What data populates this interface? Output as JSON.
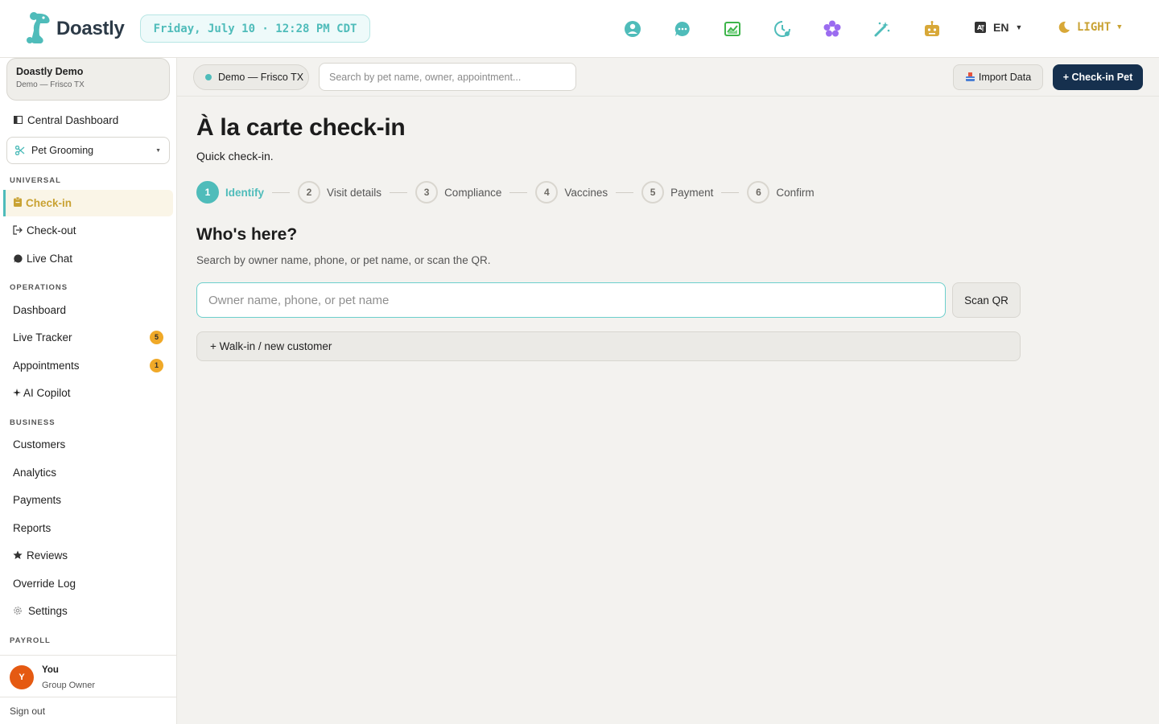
{
  "header": {
    "brand": "Doastly",
    "datetime": "Friday, July 10 · 12:28 PM CDT",
    "icons": [
      "support-icon",
      "chat-icon",
      "chart-icon",
      "clock-icon",
      "flower-icon",
      "magic-wand-icon",
      "robot-icon"
    ],
    "language": "EN",
    "theme": "LIGHT"
  },
  "sidebar": {
    "org_name": "Doastly Demo",
    "org_sub": "Demo — Frisco TX",
    "central_dashboard": "Central Dashboard",
    "service": "Pet Grooming",
    "sections": {
      "universal": "UNIVERSAL",
      "operations": "OPERATIONS",
      "business": "BUSINESS",
      "payroll": "PAYROLL"
    },
    "universal_items": [
      "Check-in",
      "Check-out",
      "Live Chat"
    ],
    "operations_items": [
      "Dashboard",
      "Live Tracker",
      "Appointments",
      "AI Copilot"
    ],
    "badges": {
      "live_tracker": "5",
      "appointments": "1"
    },
    "business_items": [
      "Customers",
      "Analytics",
      "Payments",
      "Reports",
      "Reviews",
      "Override Log",
      "Settings"
    ],
    "user": {
      "initial": "Y",
      "name": "You",
      "role": "Group Owner"
    },
    "signout": "Sign out"
  },
  "toolbar": {
    "location": "Demo — Frisco TX",
    "search_placeholder": "Search by pet name, owner, appointment...",
    "import_label": "Import Data",
    "checkin_label": "+ Check-in Pet"
  },
  "main": {
    "title": "À la carte check-in",
    "subtitle": "Quick check-in.",
    "steps": [
      {
        "num": "1",
        "label": "Identify"
      },
      {
        "num": "2",
        "label": "Visit details"
      },
      {
        "num": "3",
        "label": "Compliance"
      },
      {
        "num": "4",
        "label": "Vaccines"
      },
      {
        "num": "5",
        "label": "Payment"
      },
      {
        "num": "6",
        "label": "Confirm"
      }
    ],
    "section_title": "Who's here?",
    "section_sub": "Search by owner name, phone, or pet name, or scan the QR.",
    "input_placeholder": "Owner name, phone, or pet name",
    "scan_label": "Scan QR",
    "walkin_label": "+ Walk-in / new customer"
  },
  "colors": {
    "accent": "#4fbcba",
    "gold": "#c9a233",
    "navy": "#16304e",
    "badge": "#f0a928",
    "avatar": "#e55a12"
  }
}
